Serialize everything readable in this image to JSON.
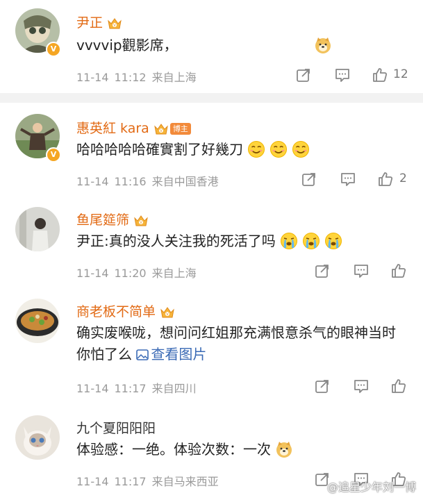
{
  "comments": [
    {
      "username": "尹正",
      "text": "vvvvip觀影席，",
      "date": "11-14",
      "time": "11:12",
      "location": "来自上海",
      "likes": "12"
    },
    {
      "username": "惠英紅 kara",
      "tag": "博主",
      "text": "哈哈哈哈哈確實割了好幾刀",
      "date": "11-14",
      "time": "11:16",
      "location": "来自中国香港",
      "likes": "2"
    },
    {
      "username": "鱼尾筵筛",
      "text": "尹正:真的没人关注我的死活了吗",
      "date": "11-14",
      "time": "11:20",
      "location": "来自上海",
      "likes": ""
    },
    {
      "username": "商老板不简单",
      "text": "确实废喉咙，想问问红姐那充满恨意杀气的眼神当时你怕了么",
      "link": "查看图片",
      "date": "11-14",
      "time": "11:17",
      "location": "来自四川",
      "likes": ""
    },
    {
      "username": "九个夏阳阳阳",
      "text": "体验感：一绝。体验次数：一次",
      "date": "11-14",
      "time": "11:17",
      "location": "来自马来西亚",
      "likes": ""
    }
  ],
  "watermark": "@追星少年刘一博",
  "colors": {
    "username": "#e26a14",
    "link": "#3a6ab5",
    "meta": "#9a9a9a",
    "badge": "#f5a623"
  },
  "icons": [
    "repost-icon",
    "comment-icon",
    "like-icon",
    "crown-icon",
    "v-badge-icon",
    "doge-emoji",
    "smile-emoji",
    "crying-emoji",
    "image-icon"
  ]
}
